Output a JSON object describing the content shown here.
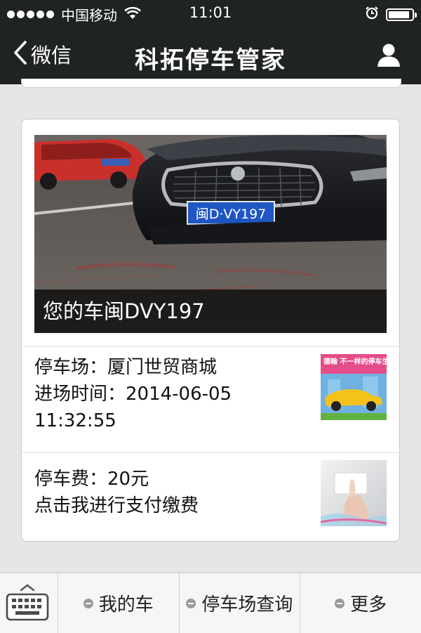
{
  "status_bar": {
    "carrier": "中国移动",
    "time": "11:01",
    "battery_level": 0.9
  },
  "nav": {
    "back_label": "微信",
    "title": "科拓停车管家"
  },
  "card": {
    "photo_caption": "您的车闽DVY197",
    "plate_text": "闽D·VY197",
    "parking": {
      "line1": "停车场：厦门世贸商城",
      "line2": "进场时间：2014-06-05",
      "line3": "11:32:55",
      "thumb_text": "德翰 不一样的停车生活"
    },
    "payment": {
      "line1": "停车费：20元",
      "line2": "点击我进行支付缴费"
    }
  },
  "bottom_menu": {
    "items": [
      {
        "label": "我的车"
      },
      {
        "label": "停车场查询"
      },
      {
        "label": "更多"
      }
    ]
  },
  "colors": {
    "header_bg": "#202324",
    "page_bg": "#e6e6e6",
    "card_bg": "#ffffff"
  }
}
